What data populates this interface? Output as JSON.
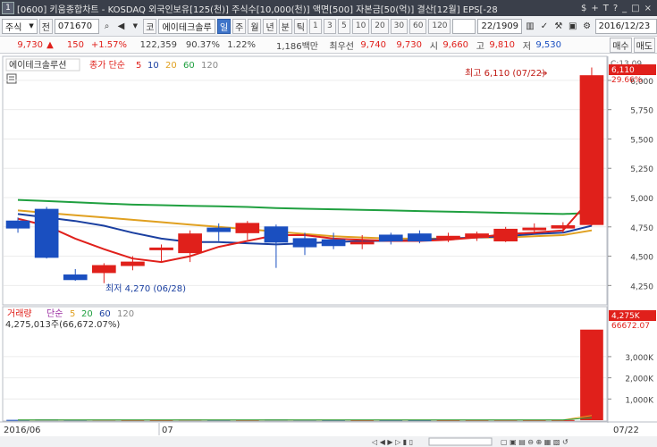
{
  "window": {
    "number": "1",
    "title": "[0600] 키움종합차트 - KOSDAQ 외국인보유[125(천)] 주식수[10,000(천)] 액면[500] 자본금[50(억)] 결산[12월] EPS[-28",
    "controls": [
      "$",
      "+",
      "T",
      "?",
      "_",
      "□",
      "×"
    ]
  },
  "toolbar": {
    "mode": "주식",
    "period_prefix": "전",
    "code": "071670",
    "market_tag": "코",
    "stock_name": "에이테크솔루",
    "periods": [
      "일",
      "주",
      "월",
      "년",
      "분",
      "틱"
    ],
    "active_period": "일",
    "intervals": [
      "1",
      "3",
      "5",
      "10",
      "20",
      "30",
      "60",
      "120"
    ],
    "page_count": "22",
    "page_total": "/1909",
    "date": "2016/12/23"
  },
  "price_bar": {
    "price": "9,730",
    "change_arrow": "▲",
    "change": "150",
    "change_rate": "+1.57%",
    "volume": "122,359",
    "volume_ratio": "90.37%",
    "turnover": "1.22%",
    "amount": "1,186백만",
    "seller": "최우선",
    "ask": "9,740",
    "bid": "9,730",
    "open_label": "시",
    "open": "9,660",
    "high_label": "고",
    "high": "9,810",
    "low_label": "저",
    "low": "9,530",
    "buy_button": "매수",
    "sell_button": "매도"
  },
  "price_pane": {
    "stock_label": "에이테크솔루션",
    "ma_label": "종가 단순",
    "ma_periods": [
      "5",
      "10",
      "20",
      "60",
      "120"
    ],
    "ma_colors": [
      "#e0201b",
      "#1a3fa0",
      "#e0a020",
      "#20a040",
      "#888888"
    ],
    "high_annotation": "최고 6,110 (07/22)",
    "low_annotation": "최저 4,270 (06/28)",
    "axis_top_label": "C:13.09",
    "current_price_tag": "6,110",
    "current_change_tag": "29.66%"
  },
  "volume_pane": {
    "title": "거래량",
    "ma_label": "단순",
    "ma_periods": [
      "5",
      "20",
      "60",
      "120"
    ],
    "summary": "4,275,013주(66,672.07%)",
    "current_volume_tag": "4,275K",
    "current_ratio_tag": "66672.07"
  },
  "x_axis": {
    "labels": [
      "2016/06",
      "07"
    ],
    "right_label": "07/22"
  },
  "chart_data": {
    "type": "candlestick",
    "price_axis": {
      "ticks": [
        4250,
        4500,
        4750,
        5000,
        5250,
        5500,
        5750,
        6000
      ],
      "tick_labels": [
        "4,250",
        "4,500",
        "4,750",
        "5,000",
        "5,250",
        "5,500",
        "5,750",
        "6,000"
      ],
      "ylim": [
        4100,
        6190
      ]
    },
    "candles": [
      {
        "o": 4800,
        "h": 4830,
        "l": 4700,
        "c": 4740
      },
      {
        "o": 4900,
        "h": 4920,
        "l": 4480,
        "c": 4490
      },
      {
        "o": 4340,
        "h": 4390,
        "l": 4290,
        "c": 4300
      },
      {
        "o": 4360,
        "h": 4440,
        "l": 4270,
        "c": 4420
      },
      {
        "o": 4420,
        "h": 4500,
        "l": 4380,
        "c": 4450
      },
      {
        "o": 4570,
        "h": 4600,
        "l": 4450,
        "c": 4570
      },
      {
        "o": 4530,
        "h": 4720,
        "l": 4450,
        "c": 4690
      },
      {
        "o": 4740,
        "h": 4780,
        "l": 4630,
        "c": 4710
      },
      {
        "o": 4700,
        "h": 4800,
        "l": 4640,
        "c": 4780
      },
      {
        "o": 4750,
        "h": 4770,
        "l": 4400,
        "c": 4620
      },
      {
        "o": 4650,
        "h": 4700,
        "l": 4510,
        "c": 4580
      },
      {
        "o": 4640,
        "h": 4700,
        "l": 4560,
        "c": 4590
      },
      {
        "o": 4620,
        "h": 4680,
        "l": 4560,
        "c": 4620
      },
      {
        "o": 4680,
        "h": 4700,
        "l": 4600,
        "c": 4630
      },
      {
        "o": 4690,
        "h": 4720,
        "l": 4610,
        "c": 4630
      },
      {
        "o": 4650,
        "h": 4700,
        "l": 4620,
        "c": 4670
      },
      {
        "o": 4660,
        "h": 4710,
        "l": 4630,
        "c": 4690
      },
      {
        "o": 4630,
        "h": 4750,
        "l": 4620,
        "c": 4730
      },
      {
        "o": 4730,
        "h": 4780,
        "l": 4690,
        "c": 4740
      },
      {
        "o": 4740,
        "h": 4790,
        "l": 4700,
        "c": 4760
      },
      {
        "o": 4770,
        "h": 6110,
        "l": 4760,
        "c": 6040
      }
    ],
    "ma5": [
      4820,
      4760,
      4650,
      4560,
      4480,
      4450,
      4500,
      4580,
      4630,
      4680,
      4680,
      4650,
      4640,
      4630,
      4630,
      4640,
      4660,
      4690,
      4700,
      4720,
      5000
    ],
    "ma10": [
      4860,
      4830,
      4800,
      4760,
      4700,
      4650,
      4620,
      4620,
      4610,
      4600,
      4610,
      4620,
      4630,
      4630,
      4640,
      4650,
      4660,
      4670,
      4690,
      4700,
      4760
    ],
    "ma20": [
      4890,
      4870,
      4850,
      4830,
      4810,
      4790,
      4770,
      4750,
      4730,
      4710,
      4690,
      4670,
      4660,
      4650,
      4650,
      4650,
      4660,
      4660,
      4670,
      4680,
      4720
    ],
    "ma60": [
      4980,
      4970,
      4960,
      4950,
      4940,
      4935,
      4930,
      4925,
      4920,
      4910,
      4905,
      4900,
      4895,
      4890,
      4885,
      4880,
      4875,
      4870,
      4865,
      4860,
      4870
    ],
    "volume": [
      15,
      30,
      18,
      22,
      12,
      10,
      25,
      16,
      14,
      28,
      20,
      12,
      10,
      11,
      9,
      10,
      12,
      14,
      10,
      9,
      4275
    ],
    "volume_axis": {
      "ticks": [
        1000,
        2000,
        3000
      ],
      "tick_labels": [
        "1,000K",
        "2,000K",
        "3,000K"
      ],
      "ylim": [
        0,
        4600
      ]
    }
  }
}
